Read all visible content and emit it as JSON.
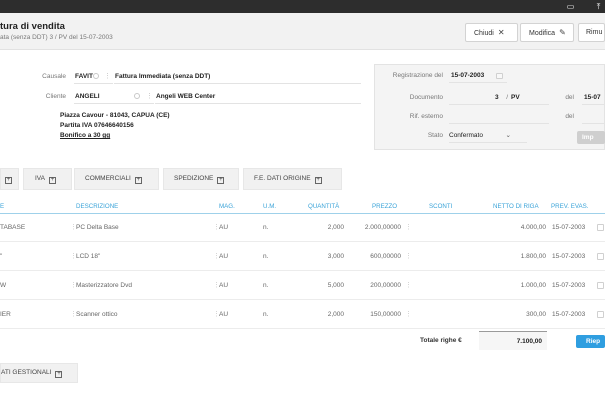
{
  "topbar": {
    "icons": [
      "window-icon",
      "upload-icon"
    ]
  },
  "header": {
    "title": "tura di vendita",
    "subtitle": "ata (senza DDT) 3 / PV del 15-07-2003",
    "buttons": {
      "close": "Chiudi",
      "edit": "Modifica",
      "remove": "Rimu"
    }
  },
  "form": {
    "causale_label": "Causale",
    "causale_code": "FAVIT",
    "causale_desc": "Fattura Immediata (senza DDT)",
    "cliente_label": "Cliente",
    "cliente_code": "ANGELI",
    "cliente_name": "Angeli WEB Center",
    "address_line1": "Piazza Cavour - 81043, CAPUA (CE)",
    "address_line2": "Partita IVA 07646640156",
    "address_line3": "Bonifico a 30 gg"
  },
  "panel": {
    "registrazione_label": "Registrazione del",
    "registrazione_date": "15-07-2003",
    "documento_label": "Documento",
    "documento_number": "3",
    "documento_slash": "/",
    "documento_series": "PV",
    "documento_del_label": "del",
    "documento_date": "15-07",
    "rif_label": "Rif. esterno",
    "rif_del_label": "del",
    "stato_label": "Stato",
    "stato_value": "Confermato",
    "imp_button": "Imp"
  },
  "tabs": {
    "tab0": "",
    "iva": "IVA",
    "commerciali": "COMMERCIALI",
    "spedizione": "SPEDIZIONE",
    "fe": "F.E. DATI ORIGINE"
  },
  "columns": {
    "codice": "E",
    "descrizione": "DESCRIZIONE",
    "mag": "MAG.",
    "um": "U.M.",
    "quantita": "QUANTITÀ",
    "prezzo": "PREZZO",
    "sconti": "SCONTI",
    "netto": "NETTO DI RIGA",
    "evas": "PREV. EVAS."
  },
  "rows": [
    {
      "codice": "TABASE",
      "descrizione": "PC Delta Base",
      "mag": "AU",
      "um": "n.",
      "quantita": "2,000",
      "prezzo": "2.000,00000",
      "netto": "4.000,00",
      "data": "15-07-2003"
    },
    {
      "codice": "\"",
      "descrizione": "LCD 18\"",
      "mag": "AU",
      "um": "n.",
      "quantita": "3,000",
      "prezzo": "600,00000",
      "netto": "1.800,00",
      "data": "15-07-2003"
    },
    {
      "codice": "W",
      "descrizione": "Masterizzatore Dvd",
      "mag": "AU",
      "um": "n.",
      "quantita": "5,000",
      "prezzo": "200,00000",
      "netto": "1.000,00",
      "data": "15-07-2003"
    },
    {
      "codice": "IER",
      "descrizione": "Scanner ottico",
      "mag": "AU",
      "um": "n.",
      "quantita": "2,000",
      "prezzo": "150,00000",
      "netto": "300,00",
      "data": "15-07-2003"
    }
  ],
  "totals": {
    "label": "Totale righe €",
    "value": "7.100,00",
    "riep_button": "Riep"
  },
  "gestionali": {
    "label": "ATI GESTIONALI"
  }
}
